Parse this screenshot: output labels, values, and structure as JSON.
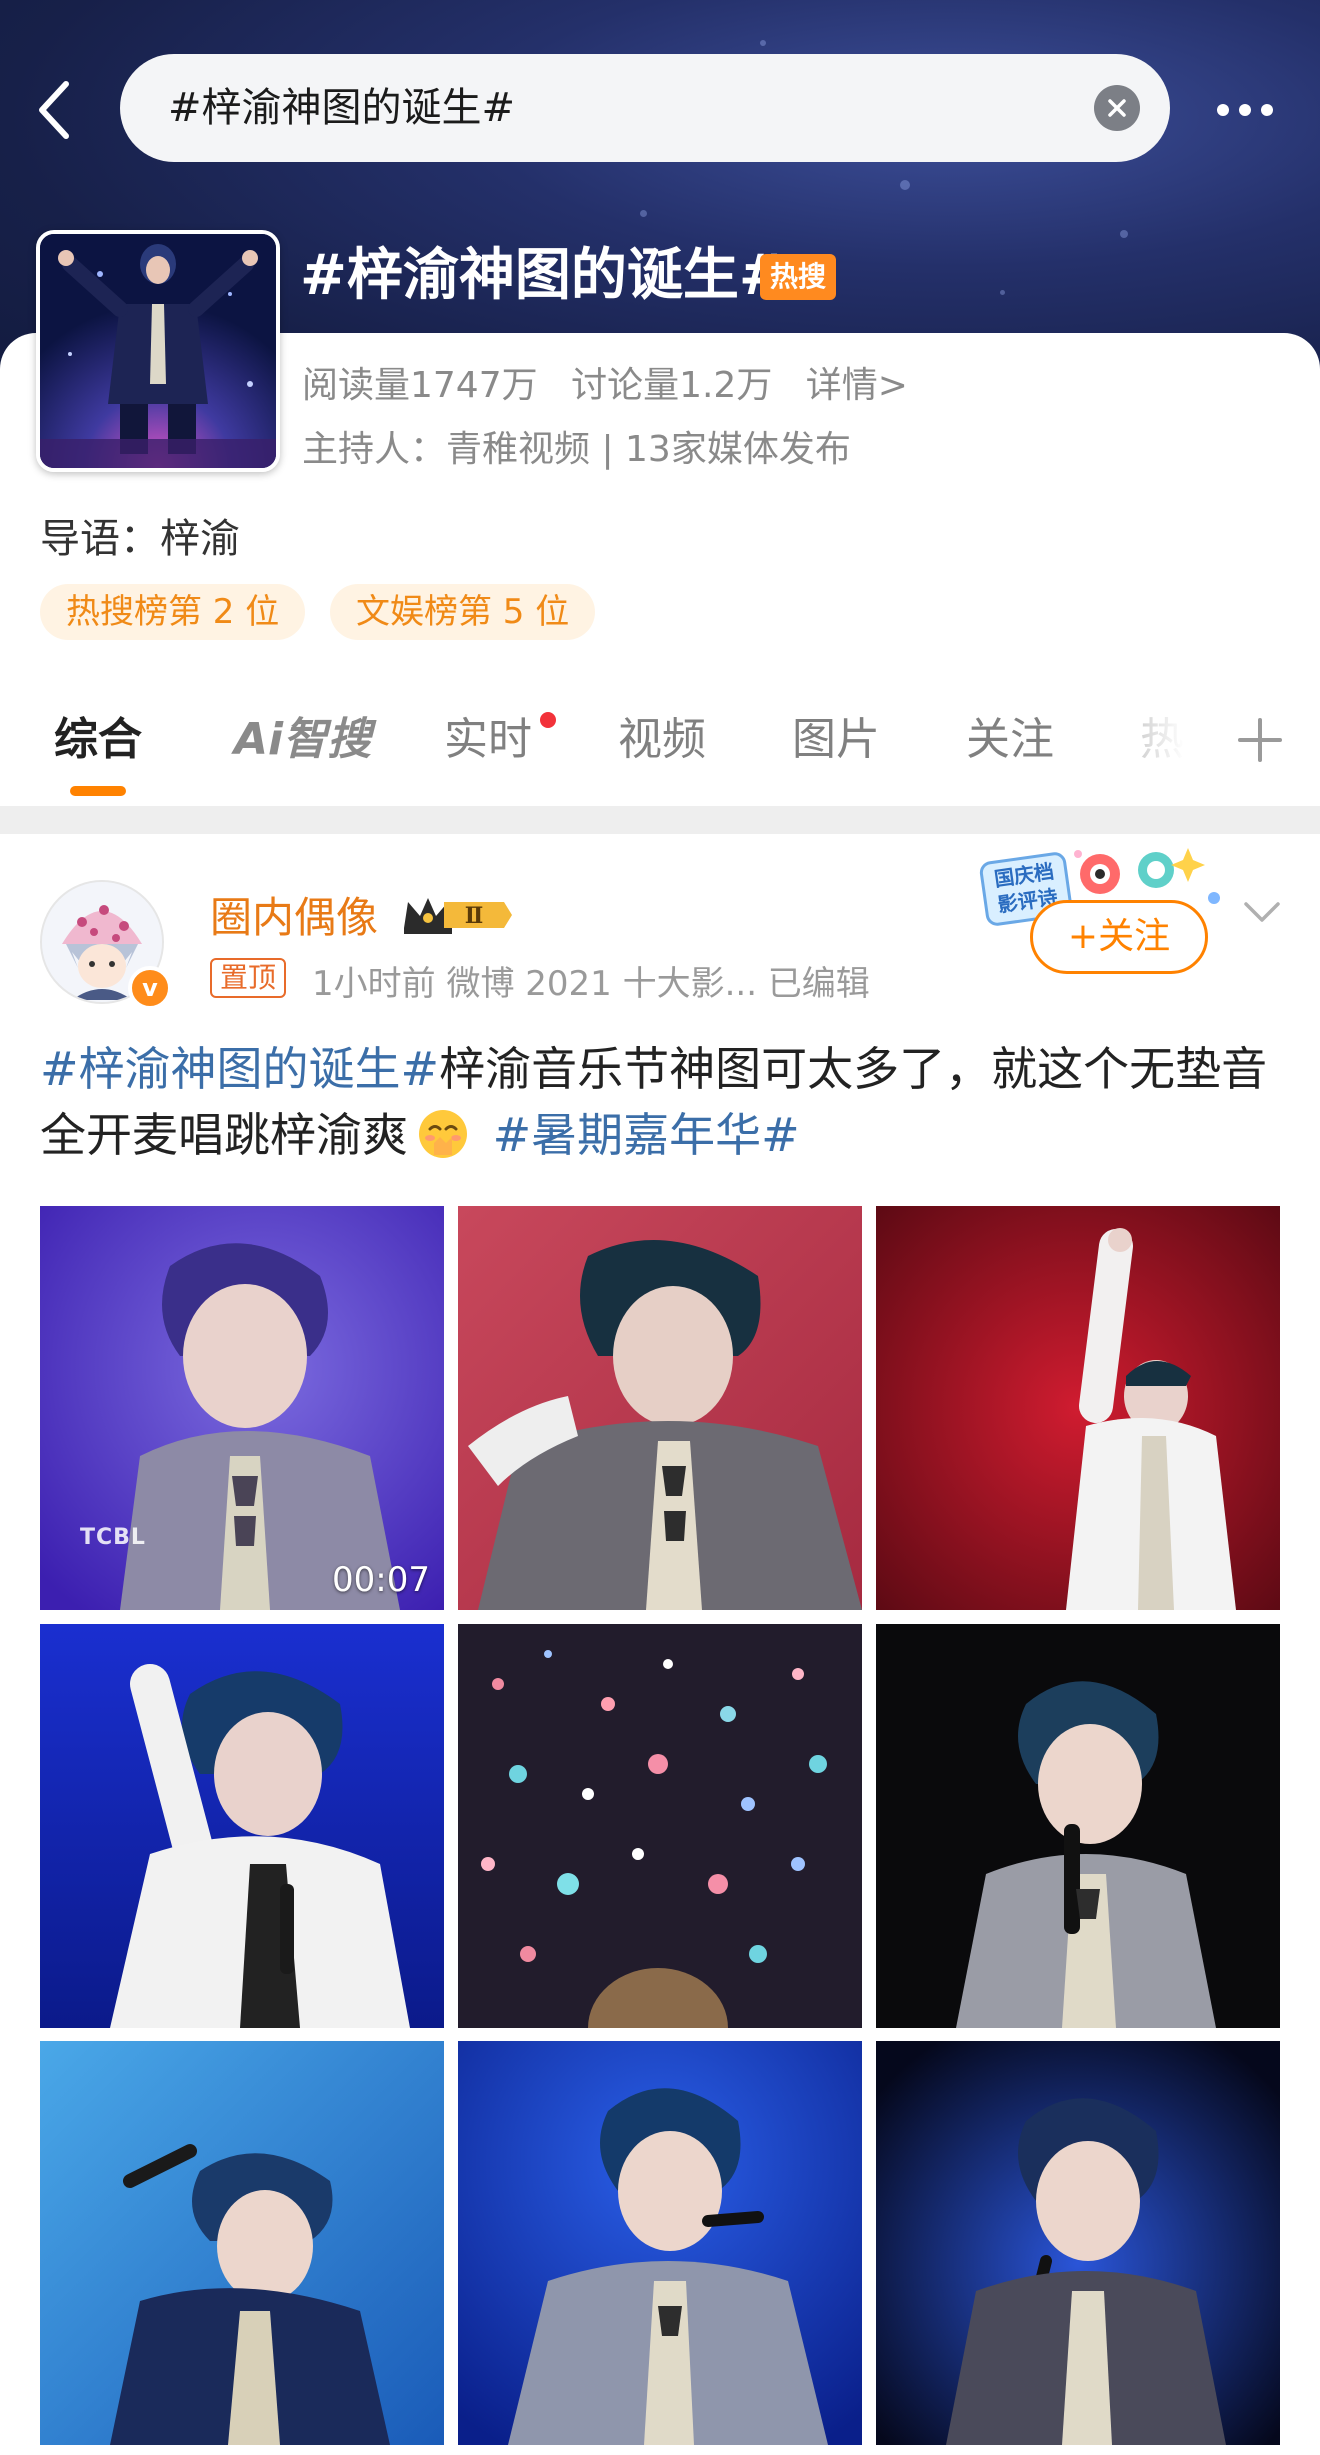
{
  "search": {
    "query": "#梓渝神图的诞生#"
  },
  "topic": {
    "title": "#梓渝神图的诞生#",
    "badge": "热搜",
    "reads": "阅读量1747万",
    "discussions": "讨论量1.2万",
    "details_link": "详情>",
    "host_line": "主持人：青稚视频 | 13家媒体发布",
    "intro": "导语：梓渝",
    "ranks": [
      "热搜榜第 2 位",
      "文娱榜第 5 位"
    ]
  },
  "tabs": [
    {
      "label": "综合",
      "active": true
    },
    {
      "label": "Ai智搜",
      "active": false
    },
    {
      "label": "实时",
      "active": false,
      "dot": true
    },
    {
      "label": "视频",
      "active": false
    },
    {
      "label": "图片",
      "active": false
    },
    {
      "label": "关注",
      "active": false
    },
    {
      "label": "热",
      "active": false
    }
  ],
  "post": {
    "author": "圈内偶像",
    "crown_level": "Ⅱ",
    "pinned_label": "置顶",
    "meta": "1小时前   微博 2021 十大影...  已编辑",
    "promo_label": "国庆档 影评诗",
    "follow_label": "+关注",
    "verify_mark": "v",
    "text_topic_1": "#梓渝神图的诞生#",
    "text_body": "梓渝音乐节神图可太多了，就这个无垫音全开麦唱跳梓渝爽",
    "text_topic_2": "#暑期嘉年华#",
    "video_duration": "00:07",
    "watermark": "TCBL"
  },
  "colors": {
    "accent": "#ff8200",
    "hot_badge": "#ff8a1f",
    "link": "#3b6ea8",
    "author": "#e87a16",
    "header_bg": "#1c2553"
  },
  "icons": [
    "back-arrow-icon",
    "clear-icon",
    "more-dots-icon",
    "plus-icon",
    "chevron-down-icon",
    "crown-icon",
    "emoji-icon"
  ]
}
